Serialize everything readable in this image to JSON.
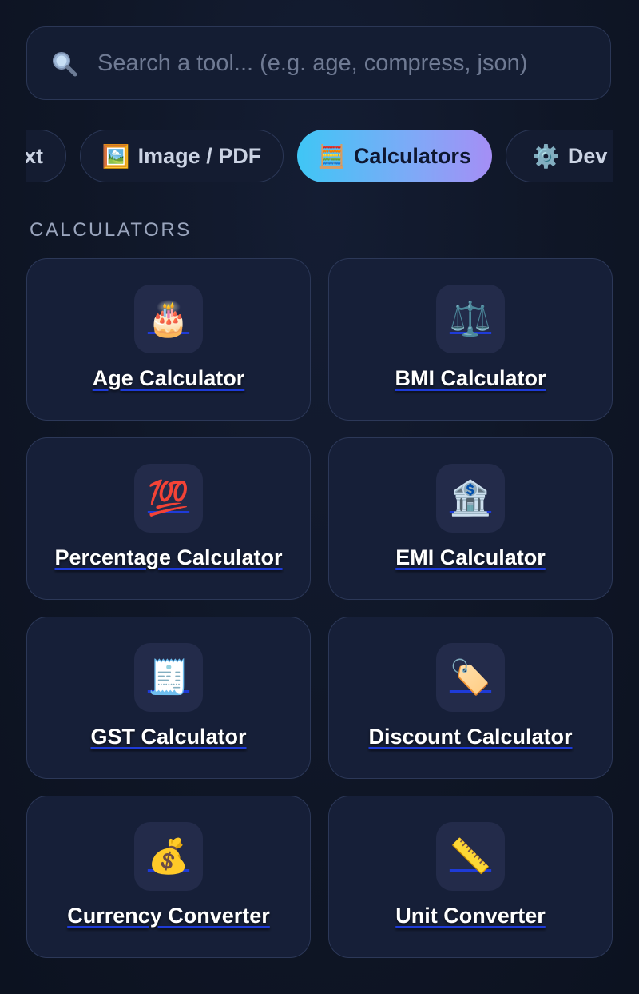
{
  "search": {
    "placeholder": "Search a tool... (e.g. age, compress, json)",
    "value": "",
    "icon": "search-icon"
  },
  "tabs": [
    {
      "label": "xt",
      "emoji": "",
      "active": false
    },
    {
      "label": "Image / PDF",
      "emoji": "🖼️",
      "active": false
    },
    {
      "label": "Calculators",
      "emoji": "🧮",
      "active": true
    },
    {
      "label": "Dev &",
      "emoji": "⚙️",
      "active": false
    }
  ],
  "section": {
    "title": "CALCULATORS"
  },
  "cards": [
    {
      "label": "Age Calculator",
      "emoji": "🎂",
      "icon": "birthday-cake-icon"
    },
    {
      "label": "BMI Calculator",
      "emoji": "⚖️",
      "icon": "balance-scale-icon"
    },
    {
      "label": "Percentage Calculator",
      "emoji": "💯",
      "icon": "hundred-points-icon"
    },
    {
      "label": "EMI Calculator",
      "emoji": "🏦",
      "icon": "bank-icon"
    },
    {
      "label": "GST Calculator",
      "emoji": "🧾",
      "icon": "receipt-icon"
    },
    {
      "label": "Discount Calculator",
      "emoji": "🏷️",
      "icon": "price-tag-icon"
    },
    {
      "label": "Currency Converter",
      "emoji": "💰",
      "icon": "money-bag-icon"
    },
    {
      "label": "Unit Converter",
      "emoji": "📏",
      "icon": "ruler-icon"
    }
  ],
  "colors": {
    "background": "#0f1626",
    "card": "#161f38",
    "border": "#2c3858",
    "accent_start": "#3fc6f5",
    "accent_end": "#a58ef5"
  }
}
